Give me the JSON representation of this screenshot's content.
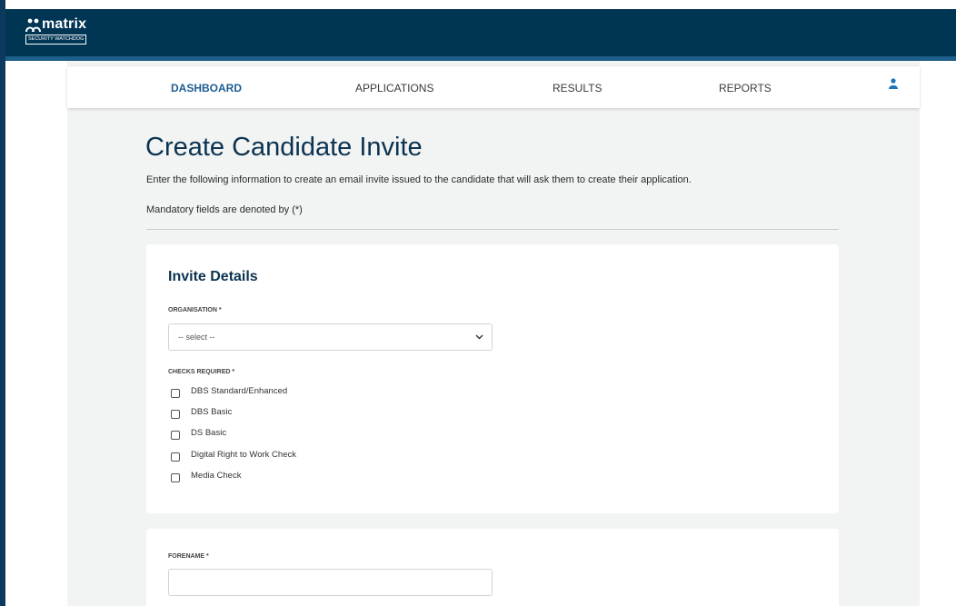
{
  "brand": {
    "name": "matrix",
    "tagline": "SECURITY WATCHDOG"
  },
  "nav": {
    "items": [
      {
        "label": "DASHBOARD",
        "active": true
      },
      {
        "label": "APPLICATIONS",
        "active": false
      },
      {
        "label": "RESULTS",
        "active": false
      },
      {
        "label": "REPORTS",
        "active": false
      }
    ],
    "user_icon": "user-icon"
  },
  "page": {
    "title": "Create Candidate Invite",
    "intro": "Enter the following information to create an email invite issued to the candidate that will ask them to create their application.",
    "mandatory_note": "Mandatory fields are denoted by (*)"
  },
  "invite_details": {
    "title": "Invite Details",
    "organisation_label": "ORGANISATION *",
    "organisation_value": "-- select --",
    "checks_label": "CHECKS REQUIRED *",
    "checks": [
      {
        "label": "DBS Standard/Enhanced",
        "checked": false
      },
      {
        "label": "DBS Basic",
        "checked": false
      },
      {
        "label": "DS Basic",
        "checked": false
      },
      {
        "label": "Digital Right to Work Check",
        "checked": false
      },
      {
        "label": "Media Check",
        "checked": false
      }
    ]
  },
  "candidate": {
    "forename_label": "FORENAME *",
    "forename_value": ""
  },
  "colors": {
    "topbar": "#003554",
    "accent": "#1d5e93",
    "title": "#0c3350",
    "background": "#f2f4f4"
  }
}
